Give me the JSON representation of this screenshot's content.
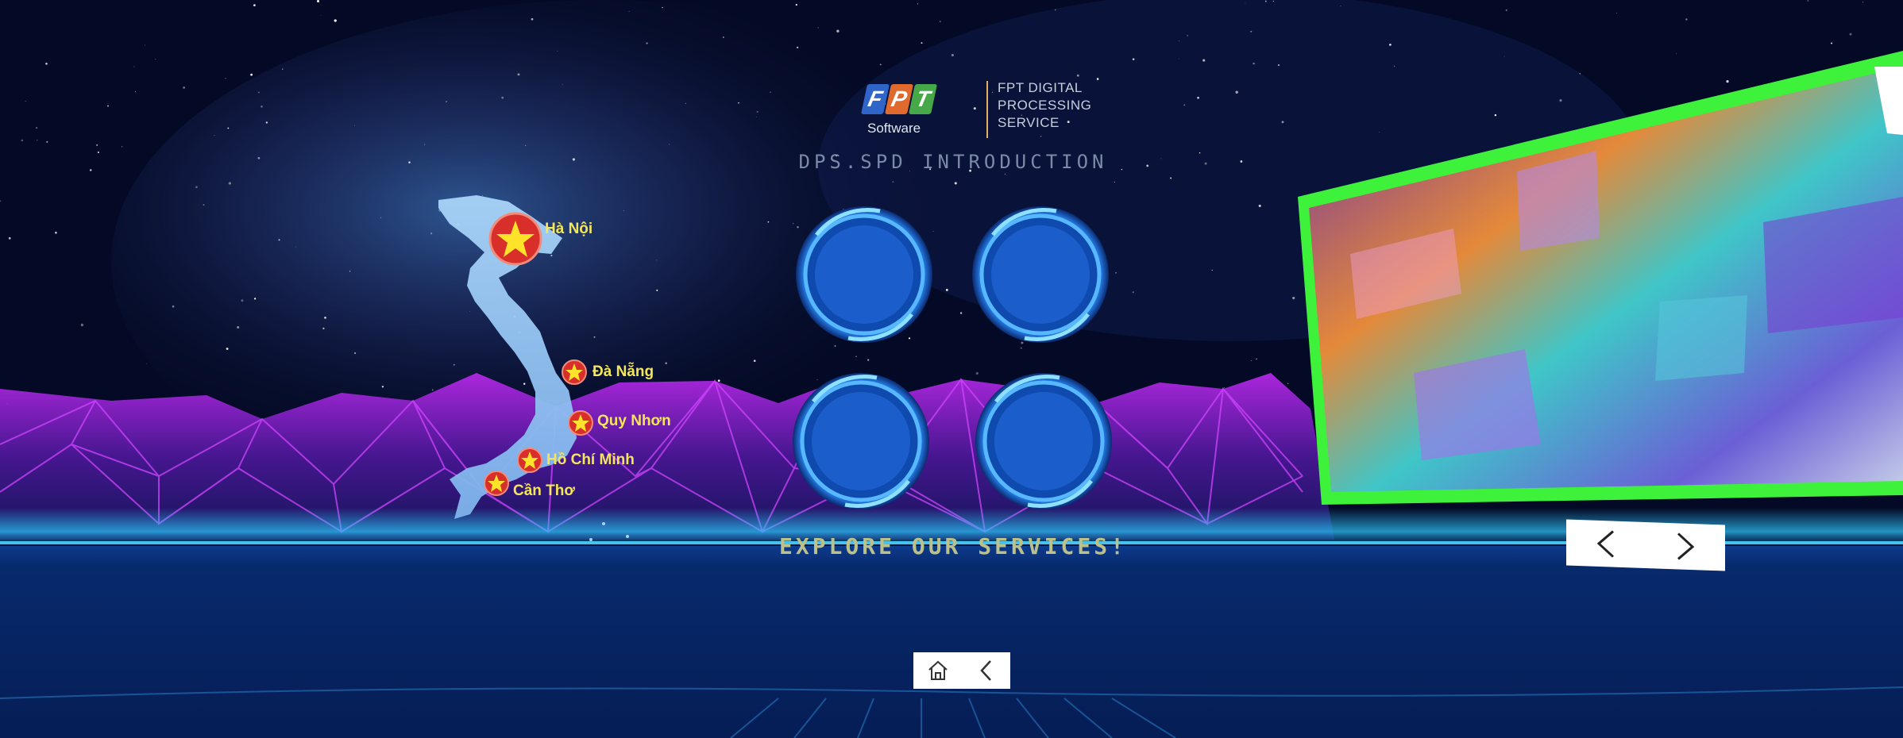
{
  "logo": {
    "letters": [
      "F",
      "P",
      "T"
    ],
    "software": "Software",
    "tagline": [
      "FPT DIGITAL",
      "PROCESSING",
      "SERVICE"
    ]
  },
  "intro_title": "DPS.SPD INTRODUCTION",
  "explore_text": "EXPLORE OUR SERVICES!",
  "map": {
    "cities": [
      "Hà Nội",
      "Đà Nẵng",
      "Quy Nhơn",
      "Hồ Chí Minh",
      "Cần Thơ"
    ]
  },
  "icons": {
    "home": "home-icon",
    "back": "chevron-left-icon",
    "prev": "chevron-left-icon",
    "next": "chevron-right-icon",
    "flag": "star-icon"
  },
  "colors": {
    "panel_border": "#3ef23b",
    "orb": "#1f6fe6",
    "city_text": "#f4e65a",
    "mountains": "#9b1fd6"
  }
}
